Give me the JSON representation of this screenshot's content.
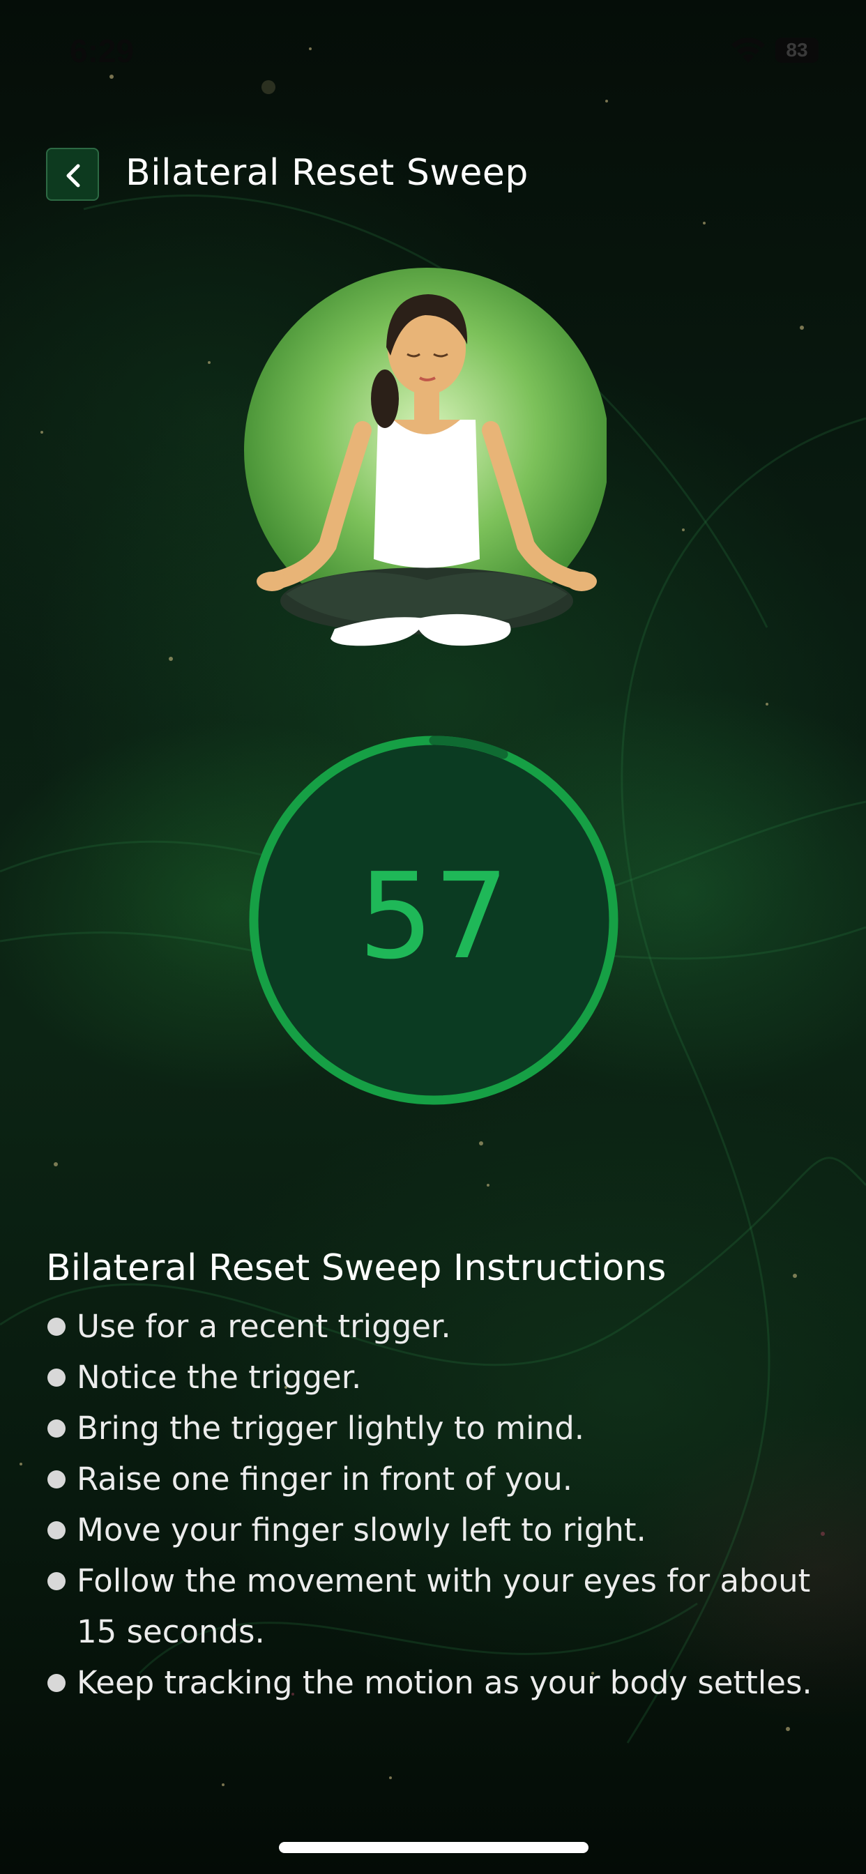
{
  "status_bar": {
    "time": "6:29",
    "battery": "83"
  },
  "header": {
    "back_icon": "chevron-left-icon",
    "title": "Bilateral Reset Sweep"
  },
  "illustration": {
    "icon": "meditation-figure",
    "accent_color": "#5aa845"
  },
  "timer": {
    "value": "57",
    "ring_color": "#16a045",
    "text_color": "#1fb858"
  },
  "instructions": {
    "title": "Bilateral Reset Sweep Instructions",
    "items": [
      "Use for a recent trigger.",
      "Notice the trigger.",
      "Bring the trigger lightly to mind.",
      "Raise one finger in front of you.",
      "Move your finger slowly left to right.",
      "Follow the movement with your eyes for about 15 seconds.",
      "Keep tracking the motion as your body settles."
    ]
  },
  "colors": {
    "background": "#061109",
    "accent": "#16a045"
  }
}
